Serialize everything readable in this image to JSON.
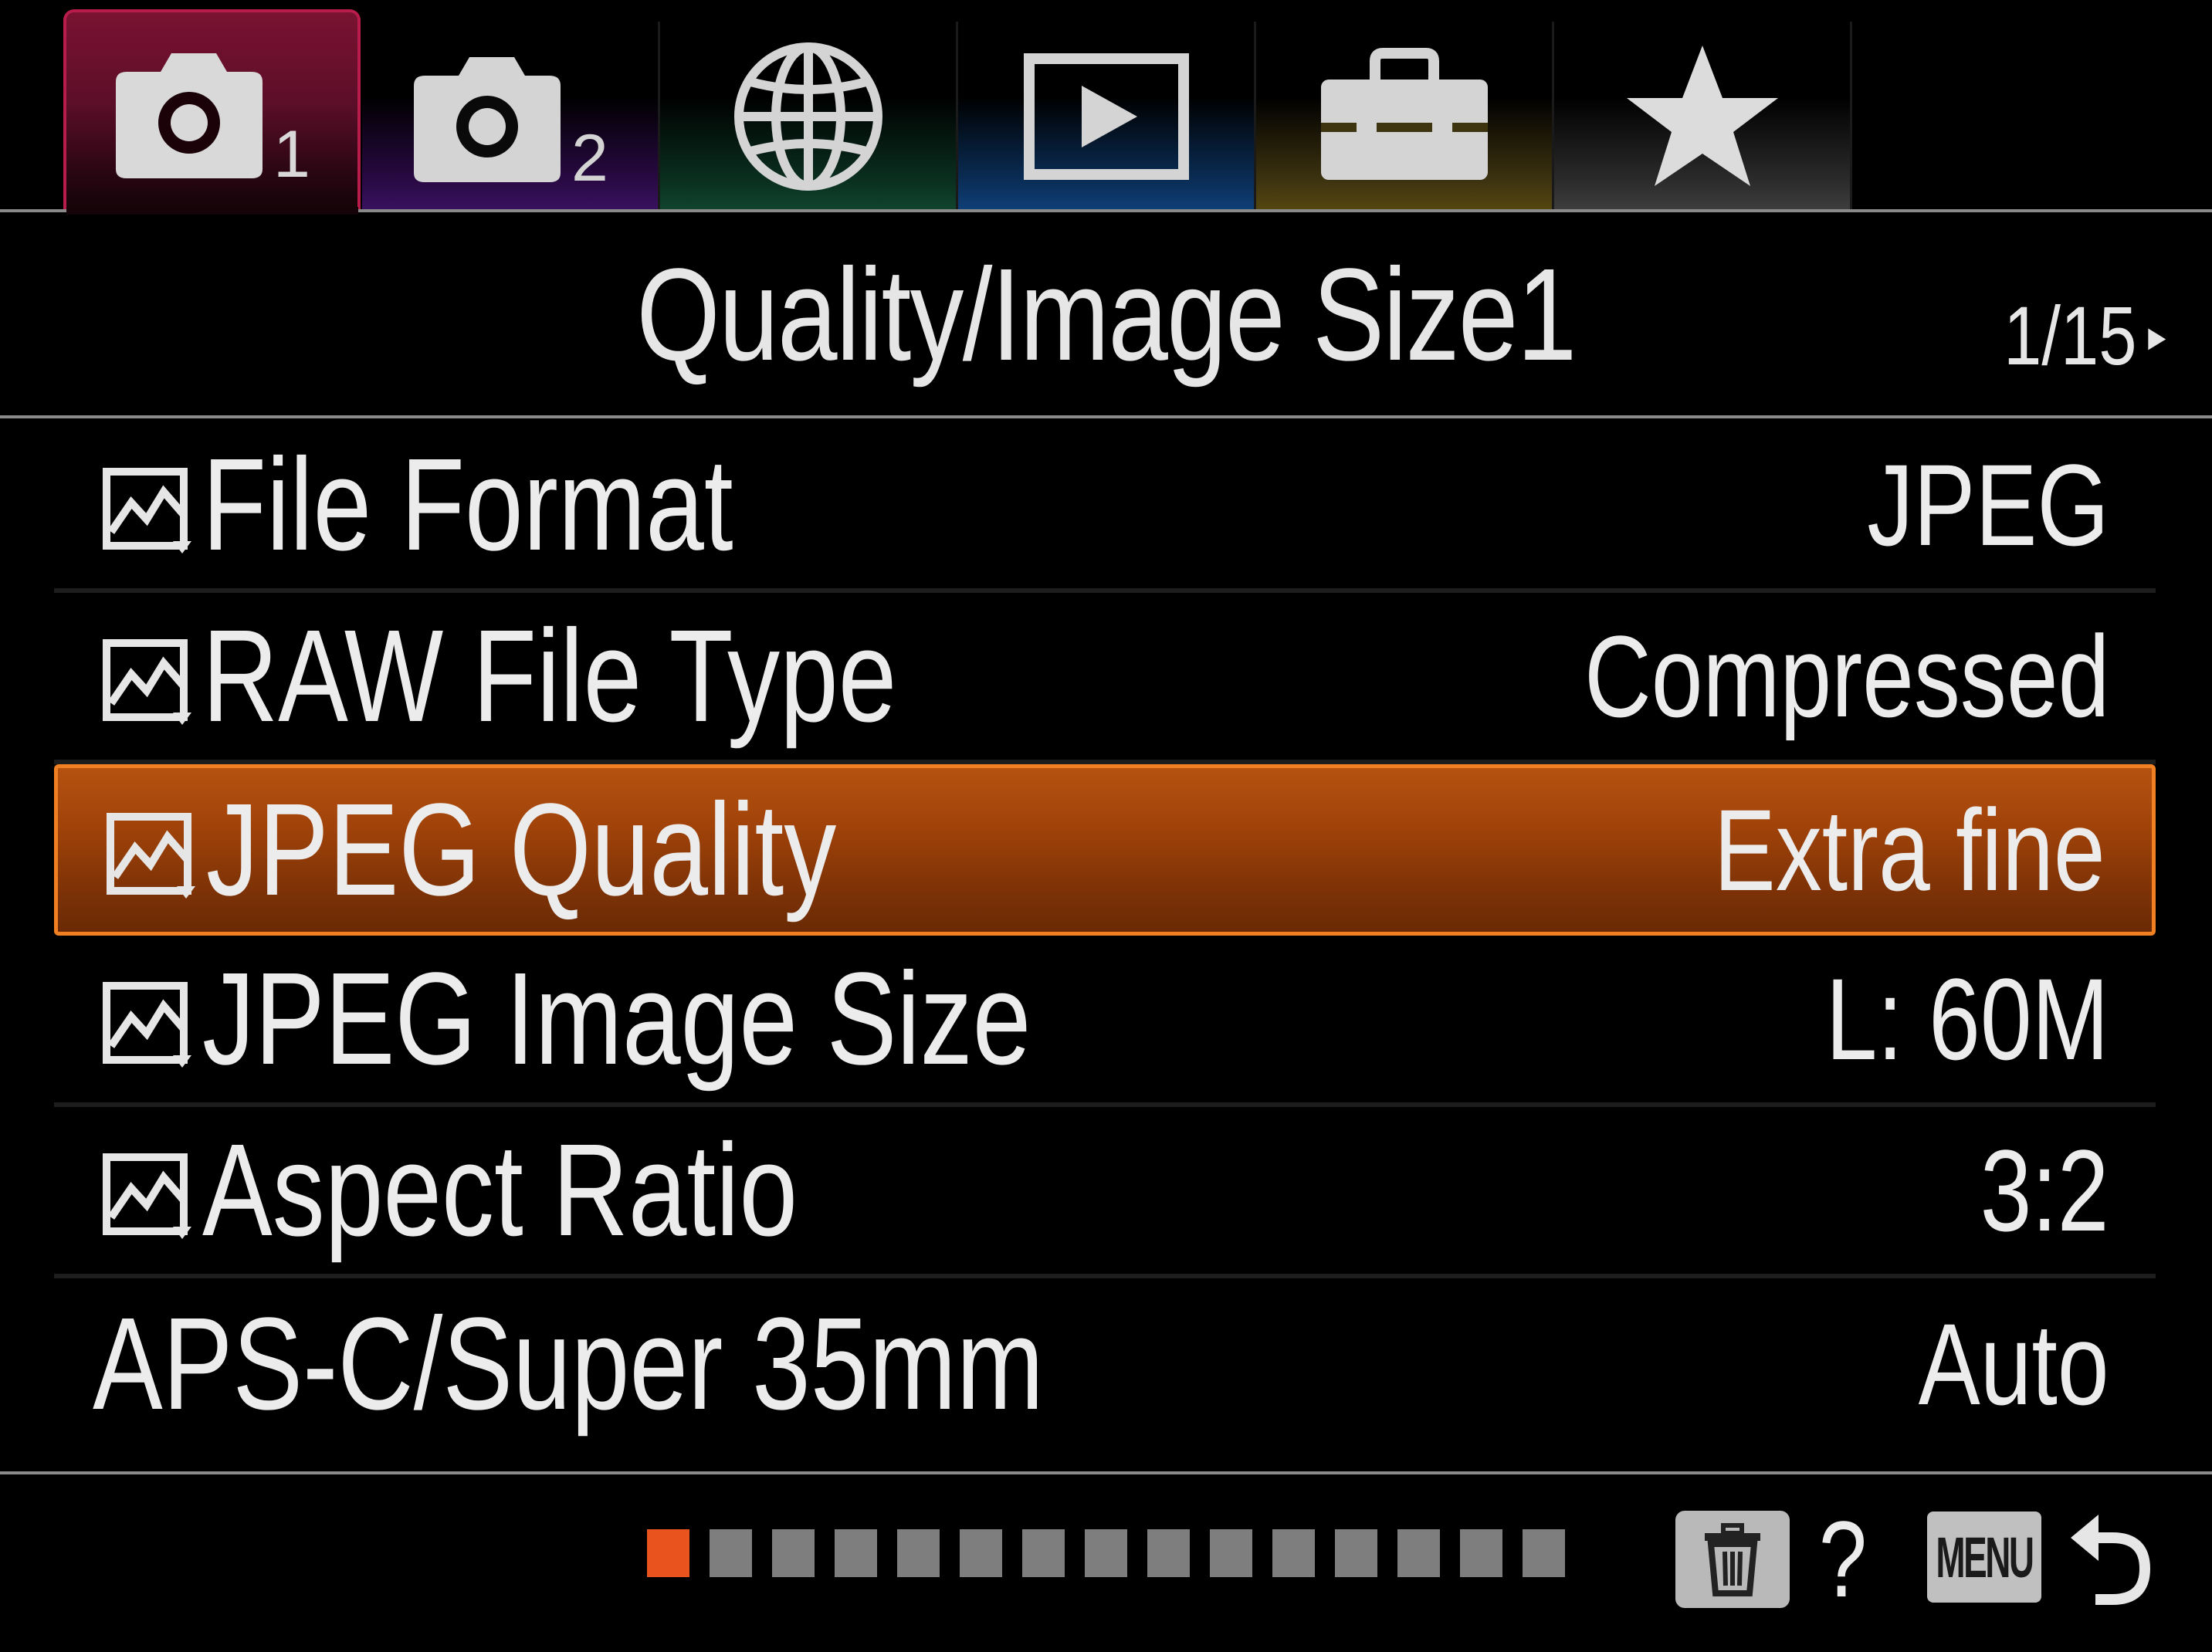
{
  "tabs": [
    {
      "name": "camera-1",
      "icon": "camera-icon",
      "number": "1",
      "active": true
    },
    {
      "name": "camera-2",
      "icon": "camera-icon",
      "number": "2",
      "active": false
    },
    {
      "name": "network",
      "icon": "globe-icon",
      "active": false
    },
    {
      "name": "playback",
      "icon": "playback-icon",
      "active": false
    },
    {
      "name": "setup",
      "icon": "toolbox-icon",
      "active": false
    },
    {
      "name": "my-menu",
      "icon": "star-icon",
      "active": false
    }
  ],
  "header": {
    "title": "Quality/Image Size1",
    "page": "1/15",
    "next_arrow": "▸"
  },
  "menu": {
    "items": [
      {
        "label": "File Format",
        "value": "JPEG",
        "icon": "still-image-icon",
        "selected": false
      },
      {
        "label": "RAW File Type",
        "value": "Compressed",
        "icon": "still-image-icon",
        "selected": false
      },
      {
        "label": "JPEG Quality",
        "value": "Extra fine",
        "icon": "still-image-icon",
        "selected": true
      },
      {
        "label": "JPEG Image Size",
        "value": "L: 60M",
        "icon": "still-image-icon",
        "selected": false
      },
      {
        "label": "Aspect Ratio",
        "value": "3:2",
        "icon": "still-image-icon",
        "selected": false
      },
      {
        "label": "APS-C/Super 35mm",
        "value": "Auto",
        "icon": null,
        "selected": false
      }
    ]
  },
  "footer": {
    "page_total": 15,
    "page_current": 1,
    "help_label": "?",
    "menu_label": "MENU",
    "colors": {
      "active_segment": "#e8531e",
      "inactive_segment": "#7e7e7e",
      "selection": "#a1430a"
    }
  }
}
